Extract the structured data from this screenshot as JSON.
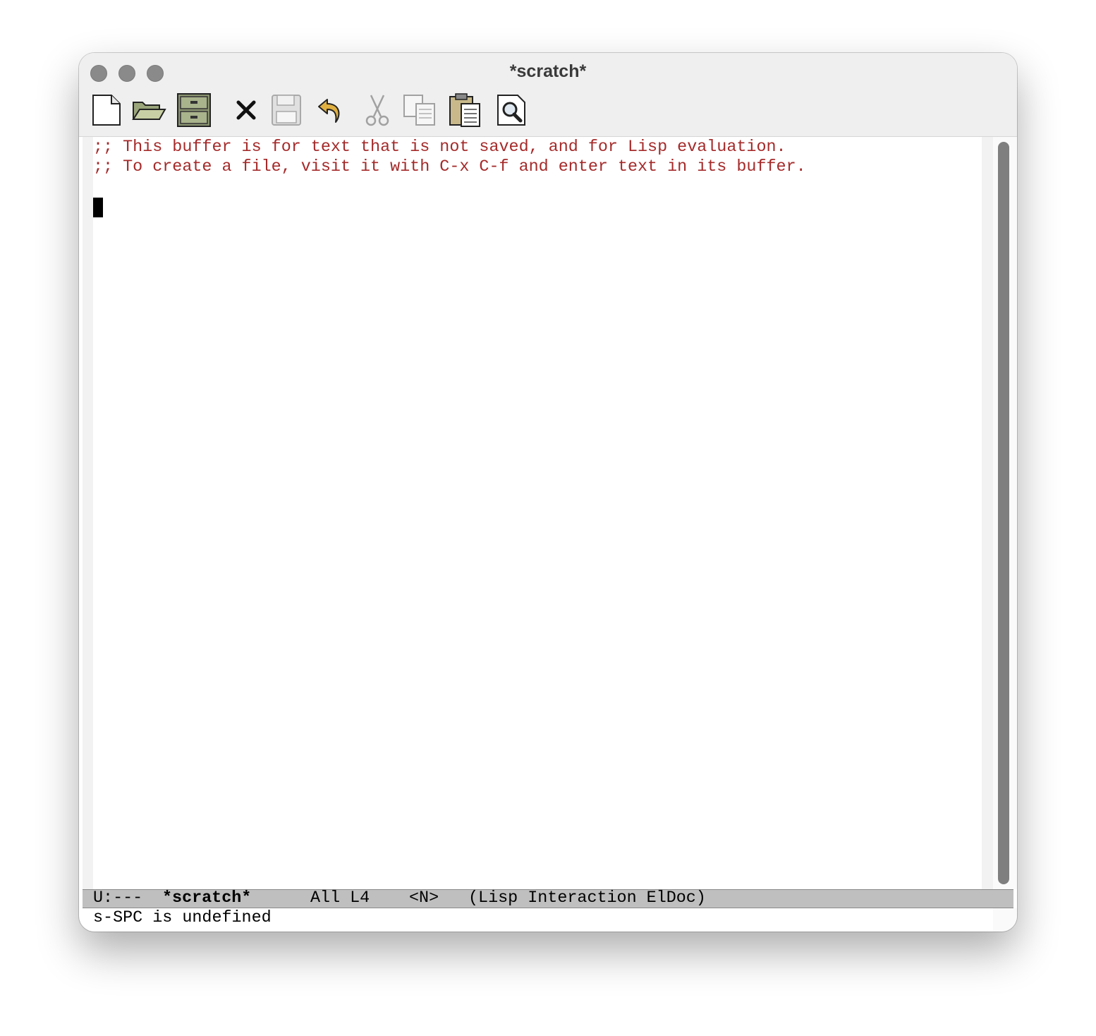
{
  "window": {
    "title": "*scratch*"
  },
  "toolbar": {
    "items": [
      {
        "icon": "new-file-icon",
        "enabled": true
      },
      {
        "icon": "open-folder-icon",
        "enabled": true
      },
      {
        "icon": "dired-cabinet-icon",
        "enabled": true
      },
      {
        "icon": "close-icon",
        "enabled": true
      },
      {
        "icon": "save-icon",
        "enabled": false
      },
      {
        "icon": "undo-icon",
        "enabled": true
      },
      {
        "icon": "cut-icon",
        "enabled": false
      },
      {
        "icon": "copy-icon",
        "enabled": false
      },
      {
        "icon": "paste-icon",
        "enabled": true
      },
      {
        "icon": "search-icon",
        "enabled": true
      }
    ]
  },
  "buffer": {
    "lines": [
      ";; This buffer is for text that is not saved, and for Lisp evaluation.",
      ";; To create a file, visit it with C-x C-f and enter text in its buffer."
    ]
  },
  "modeline": {
    "status": "U:---",
    "buffer_name": "*scratch*",
    "position": "All L4",
    "state": "<N>",
    "modes": "(Lisp Interaction ElDoc)"
  },
  "echo_area": {
    "message": "s-SPC is undefined"
  },
  "colors": {
    "comment": "#a52a2a",
    "modeline_bg": "#bfbfbf",
    "scroll_thumb": "#7f7f7f"
  }
}
